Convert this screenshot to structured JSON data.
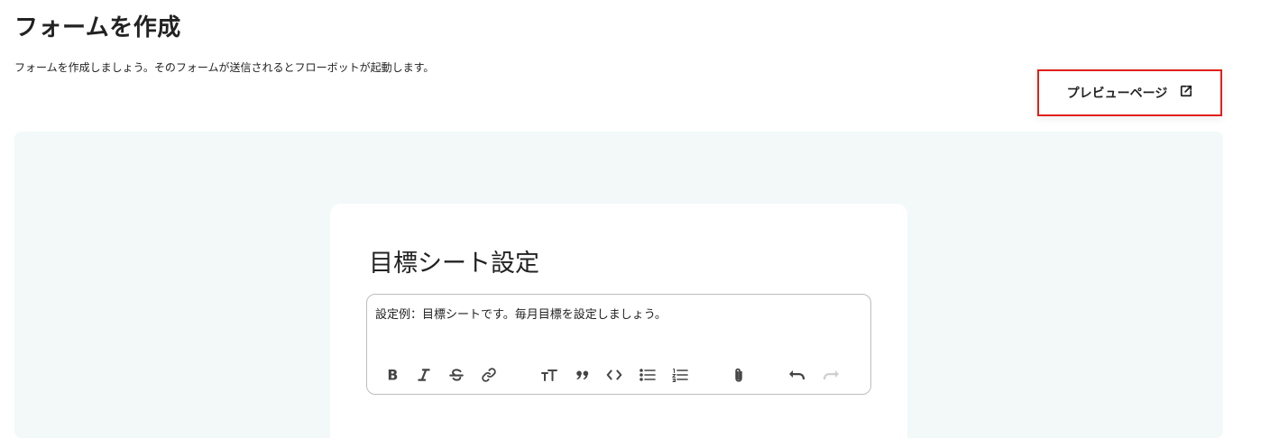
{
  "header": {
    "title": "フォームを作成",
    "description": "フォームを作成しましょう。そのフォームが送信されるとフローボットが起動します。"
  },
  "preview_button": {
    "label": "プレビューページ",
    "icon": "external-link-icon"
  },
  "form": {
    "title": "目標シート設定",
    "editor_text": "設定例：目標シートです。毎月目標を設定しましょう。",
    "toolbar": [
      {
        "name": "bold",
        "icon": "bold-icon"
      },
      {
        "name": "italic",
        "icon": "italic-icon"
      },
      {
        "name": "strikethrough",
        "icon": "strikethrough-icon"
      },
      {
        "name": "link",
        "icon": "link-icon"
      },
      {
        "name": "heading",
        "icon": "heading-icon"
      },
      {
        "name": "quote",
        "icon": "quote-icon"
      },
      {
        "name": "code",
        "icon": "code-icon"
      },
      {
        "name": "bullet-list",
        "icon": "bullet-list-icon"
      },
      {
        "name": "numbered-list",
        "icon": "numbered-list-icon"
      },
      {
        "name": "attach",
        "icon": "paperclip-icon"
      },
      {
        "name": "undo",
        "icon": "undo-icon"
      },
      {
        "name": "redo",
        "icon": "redo-icon",
        "disabled": true
      }
    ]
  },
  "colors": {
    "highlight_border": "#e0201b",
    "canvas_background": "#f2f9f8"
  }
}
